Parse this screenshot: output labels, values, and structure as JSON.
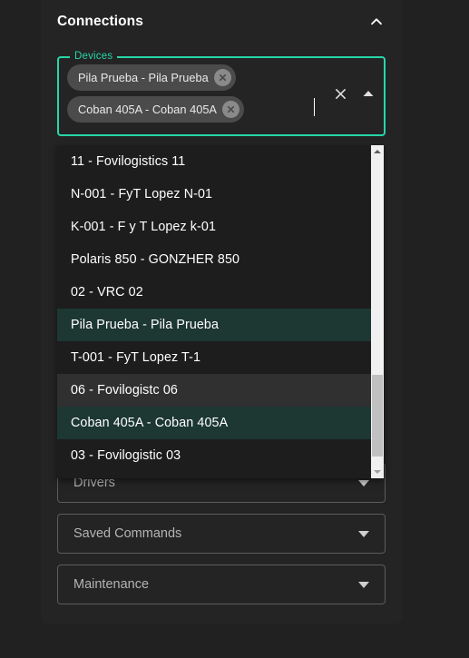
{
  "panel": {
    "title": "Connections",
    "collapse_icon": "chevron-up-icon"
  },
  "devices_field": {
    "legend": "Devices",
    "chips": [
      {
        "label": "Pila Prueba - Pila Prueba",
        "remove_icon": "close-circle-icon"
      },
      {
        "label": "Coban 405A - Coban 405A",
        "remove_icon": "close-circle-icon"
      }
    ],
    "clear_icon": "close-icon",
    "toggle_icon": "triangle-up-icon",
    "caret_visible": true
  },
  "dropdown": {
    "options": [
      {
        "label": "11 - Fovilogistics 11",
        "state": "normal"
      },
      {
        "label": "N-001 - FyT Lopez N-01",
        "state": "normal"
      },
      {
        "label": "K-001 - F y T Lopez k-01",
        "state": "normal"
      },
      {
        "label": "Polaris 850 - GONZHER 850",
        "state": "normal"
      },
      {
        "label": "02 - VRC 02",
        "state": "normal"
      },
      {
        "label": "Pila Prueba - Pila Prueba",
        "state": "selected"
      },
      {
        "label": "T-001 - FyT Lopez T-1",
        "state": "normal"
      },
      {
        "label": "06 - Fovilogistc 06",
        "state": "hovered"
      },
      {
        "label": "Coban 405A - Coban 405A",
        "state": "selected"
      },
      {
        "label": "03 - Fovilogistic 03",
        "state": "normal"
      }
    ],
    "scrollbar": {
      "up_icon": "scroll-up-arrow-icon",
      "down_icon": "scroll-down-arrow-icon"
    }
  },
  "sections": [
    {
      "label": "Drivers",
      "arrow_icon": "triangle-down-icon"
    },
    {
      "label": "Saved Commands",
      "arrow_icon": "triangle-down-icon"
    },
    {
      "label": "Maintenance",
      "arrow_icon": "triangle-down-icon"
    }
  ],
  "colors": {
    "accent": "#26d7a8",
    "selected_row": "#1d3733",
    "hover_row": "#303030",
    "page_bg": "#212121",
    "panel_bg": "#242424",
    "dropdown_bg": "#1d1d1d",
    "chip_bg": "#4b4b4b"
  }
}
